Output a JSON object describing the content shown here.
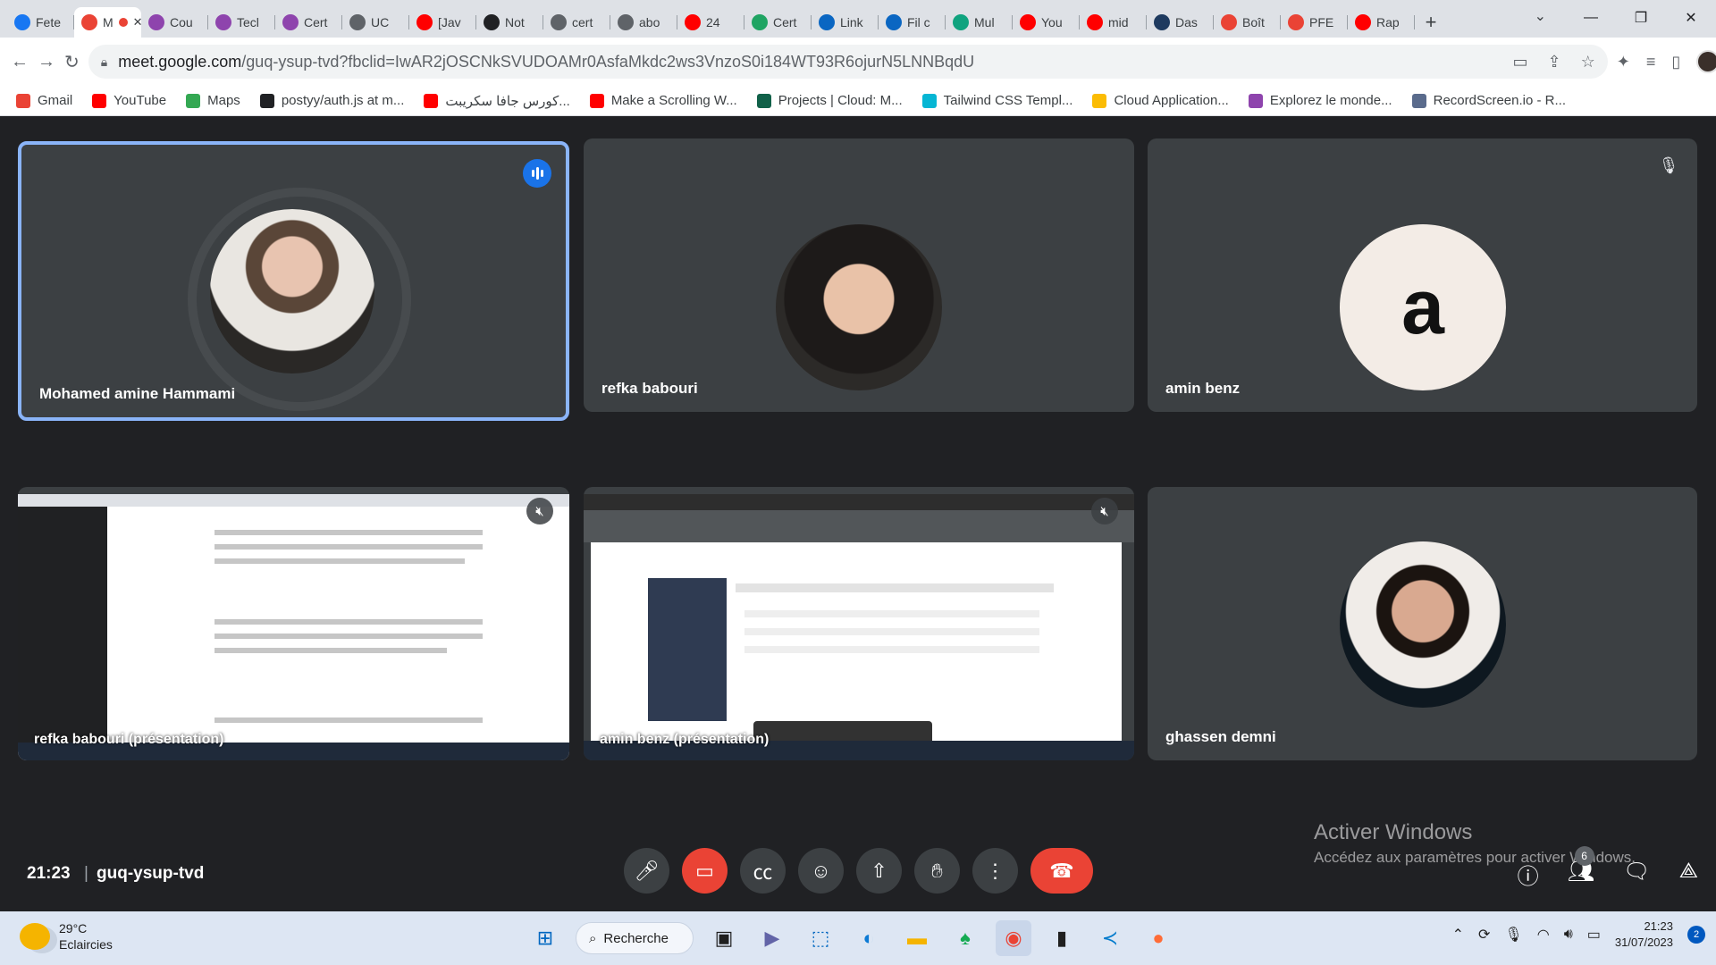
{
  "browser": {
    "tabs": [
      {
        "label": "Fete",
        "color": "#1877f2"
      },
      {
        "label": "M",
        "color": "#ea4335",
        "active": true
      },
      {
        "label": "Cou",
        "color": "#8e44ad"
      },
      {
        "label": "Tecl",
        "color": "#8e44ad"
      },
      {
        "label": "Cert",
        "color": "#8e44ad"
      },
      {
        "label": "UC",
        "color": "#5f6368"
      },
      {
        "label": "[Jav",
        "color": "#ff0000"
      },
      {
        "label": "Not",
        "color": "#202124"
      },
      {
        "label": "cert",
        "color": "#5f6368"
      },
      {
        "label": "abo",
        "color": "#5f6368"
      },
      {
        "label": "24",
        "color": "#ff0000"
      },
      {
        "label": "Cert",
        "color": "#1fa463"
      },
      {
        "label": "Link",
        "color": "#0a66c2"
      },
      {
        "label": "Fil c",
        "color": "#0a66c2"
      },
      {
        "label": "Mul",
        "color": "#10a37f"
      },
      {
        "label": "You",
        "color": "#ff0000"
      },
      {
        "label": "mid",
        "color": "#ff0000"
      },
      {
        "label": "Das",
        "color": "#1e3a5f"
      },
      {
        "label": "Boît",
        "color": "#ea4335"
      },
      {
        "label": "PFE",
        "color": "#ea4335"
      },
      {
        "label": "Rap",
        "color": "#ff0000"
      }
    ],
    "url_host": "meet.google.com",
    "url_path": "/guq-ysup-tvd?fbclid=IwAR2jOSCNkSVUDOAMr0AsfaMkdc2ws3VnzoS0i184WT93R6ojurN5LNNBqdU",
    "bookmarks": [
      {
        "label": "Gmail",
        "color": "#ea4335"
      },
      {
        "label": "YouTube",
        "color": "#ff0000"
      },
      {
        "label": "Maps",
        "color": "#34a853"
      },
      {
        "label": "postyy/auth.js at m...",
        "color": "#202124"
      },
      {
        "label": "كورس جافا سكريبت...",
        "color": "#ff0000"
      },
      {
        "label": "Make a Scrolling W...",
        "color": "#ff0000"
      },
      {
        "label": "Projects | Cloud: M...",
        "color": "#116149"
      },
      {
        "label": "Tailwind CSS Templ...",
        "color": "#06b6d4"
      },
      {
        "label": "Cloud Application...",
        "color": "#fbbc04"
      },
      {
        "label": "Explorez le monde...",
        "color": "#8e44ad"
      },
      {
        "label": "RecordScreen.io - R...",
        "color": "#5a6b8c"
      }
    ]
  },
  "meet": {
    "participants": [
      {
        "name": "Mohamed amine Hammami"
      },
      {
        "name": "refka babouri"
      },
      {
        "name": "amin benz",
        "initial": "a"
      },
      {
        "name": "ghassen demni"
      }
    ],
    "presentations": [
      {
        "label": "refka babouri (présentation)"
      },
      {
        "label": "amin benz (présentation)"
      }
    ],
    "time": "21:23",
    "meeting_code": "guq-ysup-tvd",
    "participant_count": "6",
    "watermark_title": "Activer Windows",
    "watermark_sub": "Accédez aux paramètres pour activer Windows."
  },
  "taskbar": {
    "temperature": "29°C",
    "condition": "Eclaircies",
    "search_label": "Recherche",
    "clock_time": "21:23",
    "clock_date": "31/07/2023",
    "notification_count": "2"
  }
}
